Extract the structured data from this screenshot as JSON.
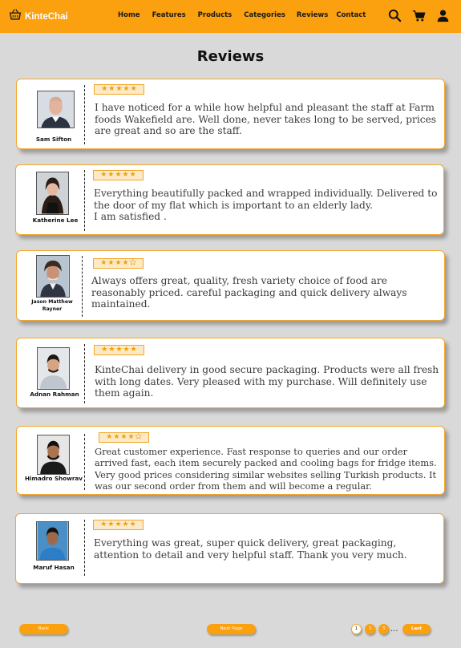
{
  "header": {
    "logo_text": "KinteChai",
    "nav": [
      {
        "label": "Home"
      },
      {
        "label": "Features"
      },
      {
        "label": "Products"
      },
      {
        "label": "Categories"
      },
      {
        "label": "Reviews"
      },
      {
        "label": "Contact"
      }
    ],
    "icons": [
      "search-icon",
      "cart-icon",
      "user-icon"
    ]
  },
  "page_title": "Reviews",
  "reviews": [
    {
      "name": "Sam Sifton",
      "rating": 5,
      "text": "I have noticed for a while how helpful and pleasant the staff at Farm foods Wakefield are. Well done, never takes long to be served, prices are great and so are the staff."
    },
    {
      "name": "Katherine Lee",
      "rating": 5,
      "text": "Everything beautifully packed and wrapped individually. Delivered to the door of my flat which is important to an elderly lady.\nI am satisfied ."
    },
    {
      "name": "Jason Matthew Rayner",
      "rating": 4,
      "text": "Always offers great, quality, fresh variety choice of food are reasonably priced. careful packaging and quick delivery always maintained."
    },
    {
      "name": "Adnan Rahman",
      "rating": 5,
      "text": "KinteChai delivery in good secure packaging. Products were all fresh with long dates. Very pleased with my purchase. Will definitely use them again."
    },
    {
      "name": "Himadro Showrav",
      "rating": 4,
      "text": "Great customer experience. Fast response to queries and our order arrived fast, each item securely packed and cooling bags for fridge items. Very good prices considering similar websites selling Turkish products. It was our second order from them and will become a regular."
    },
    {
      "name": "Maruf Hasan",
      "rating": 5,
      "text": "Everything was great, super quick delivery, great packaging, attention to detail and very helpful staff. Thank you very much."
    }
  ],
  "pagination": {
    "back_label": "Back",
    "next_label": "Next Page",
    "pages": [
      "1",
      "2",
      "3"
    ],
    "current_page": "1",
    "ellipsis": "...",
    "last_label": "Last"
  },
  "colors": {
    "accent": "#fba00e",
    "star": "#f5a000",
    "background": "#d9d9d9"
  }
}
